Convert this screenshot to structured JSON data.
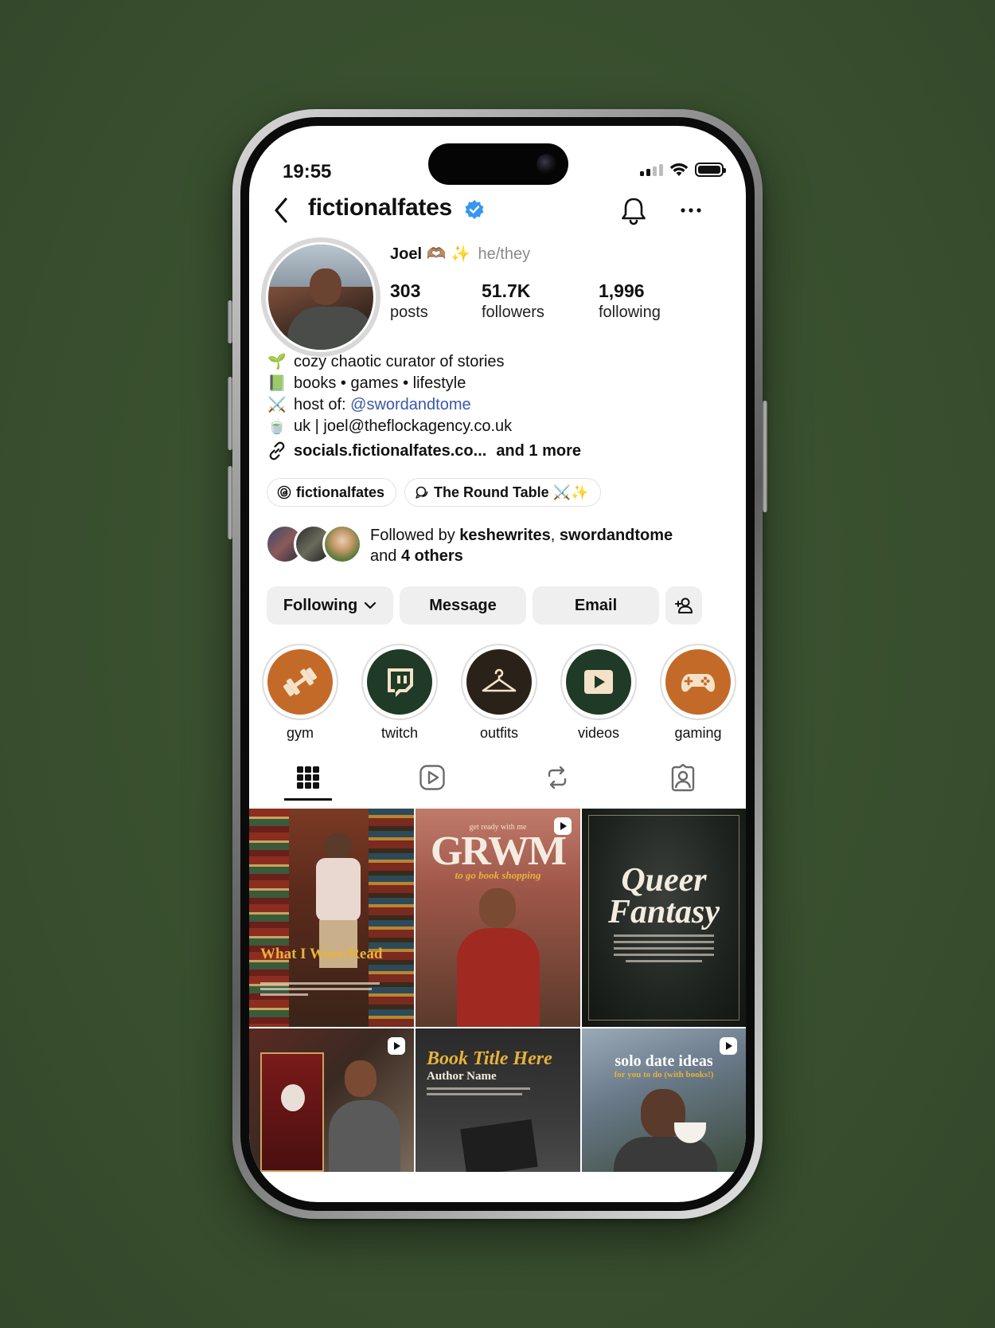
{
  "colors": {
    "background": "#3b5231",
    "accent_brown": "#c46a28",
    "accent_green": "#1f3a27",
    "mention": "#3a58a6",
    "verified": "#3897f0"
  },
  "status_bar": {
    "time": "19:55"
  },
  "header": {
    "username": "fictionalfates",
    "icons": [
      "back-icon",
      "verified-icon",
      "bell-icon",
      "more-icon"
    ]
  },
  "profile": {
    "name": "Joel 🫶🏽 ✨",
    "pronouns": "he/they",
    "stats": [
      {
        "value": "303",
        "label": "posts"
      },
      {
        "value": "51.7K",
        "label": "followers"
      },
      {
        "value": "1,996",
        "label": "following"
      }
    ]
  },
  "bio": {
    "line1": {
      "emoji": "🌱",
      "text": "cozy chaotic curator of stories"
    },
    "line2": {
      "emoji": "📗",
      "text": "books • games • lifestyle"
    },
    "line3": {
      "emoji": "⚔️",
      "prefix": "host of: ",
      "mention": "@swordandtome"
    },
    "line4": {
      "emoji": "🍵",
      "text": "uk | joel@theflockagency.co.uk"
    },
    "link": "socials.fictionalfates.co...",
    "link_more": "and 1 more"
  },
  "chips": [
    {
      "label": "fictionalfates",
      "icon": "threads-icon"
    },
    {
      "label": "The Round Table ⚔️✨",
      "icon": "channel-icon"
    }
  ],
  "followed_by": {
    "prefix": "Followed by ",
    "user1": "keshewrites",
    "sep": ", ",
    "user2": "swordandtome",
    "and": "and ",
    "others": "4 others"
  },
  "actions": {
    "following": "Following",
    "message": "Message",
    "email": "Email"
  },
  "highlights": [
    {
      "label": "gym",
      "icon": "dumbbell-icon"
    },
    {
      "label": "twitch",
      "icon": "twitch-icon"
    },
    {
      "label": "outfits",
      "icon": "hanger-icon"
    },
    {
      "label": "videos",
      "icon": "play-icon"
    },
    {
      "label": "gaming",
      "icon": "gamepad-icon"
    }
  ],
  "tabs": [
    "grid-icon",
    "reels-icon",
    "reposts-icon",
    "tagged-icon"
  ],
  "posts": {
    "p1": {
      "title": "What I Wore/Read"
    },
    "p2": {
      "kicker": "get ready with me",
      "title": "GRWM",
      "subtitle": "to go book shopping"
    },
    "p3": {
      "title": "Queer Fantasy"
    },
    "p5": {
      "title": "Book Title Here",
      "subtitle": "Author Name"
    },
    "p6": {
      "title": "solo date ideas",
      "subtitle": "for you to do (with books!)"
    }
  }
}
